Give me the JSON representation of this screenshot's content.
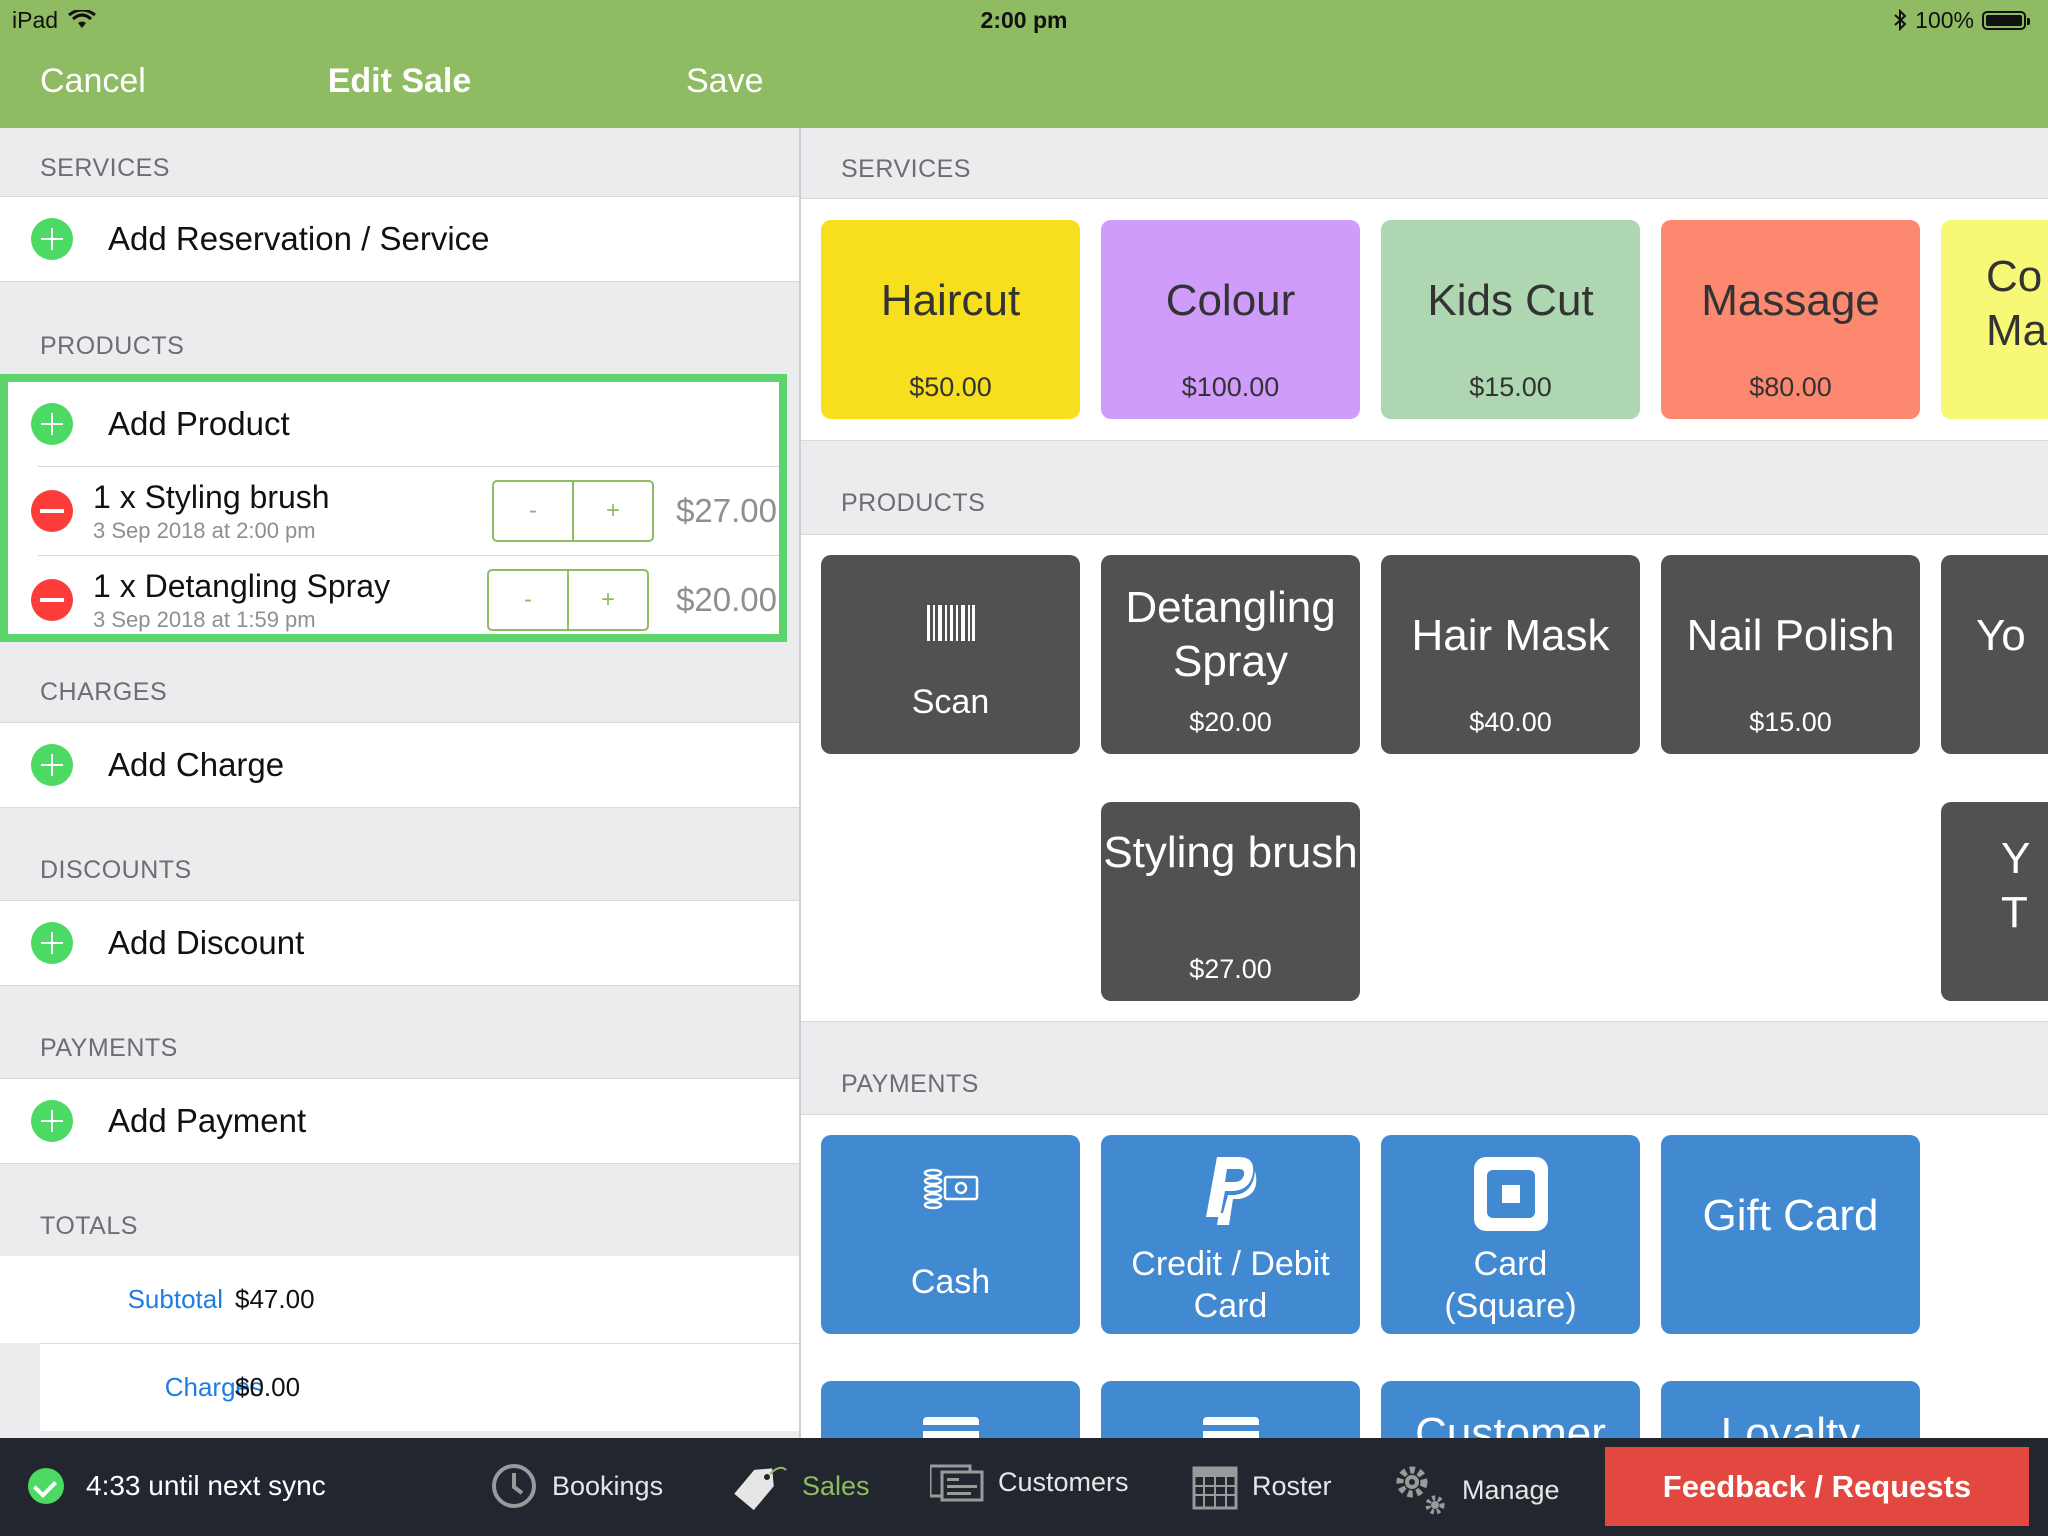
{
  "status_bar": {
    "device": "iPad",
    "time": "2:00 pm",
    "battery": "100%"
  },
  "nav": {
    "cancel": "Cancel",
    "title": "Edit Sale",
    "save": "Save"
  },
  "left": {
    "services_header": "SERVICES",
    "add_service": "Add Reservation / Service",
    "products_header": "PRODUCTS",
    "add_product": "Add Product",
    "items": [
      {
        "name": "1 x Styling brush",
        "date": "3 Sep 2018 at 2:00 pm",
        "minus": "-",
        "plus": "+",
        "price": "$27.00"
      },
      {
        "name": "1 x Detangling Spray",
        "date": "3 Sep 2018 at 1:59 pm",
        "minus": "-",
        "plus": "+",
        "price": "$20.00"
      }
    ],
    "charges_header": "CHARGES",
    "add_charge": "Add Charge",
    "discounts_header": "DISCOUNTS",
    "add_discount": "Add Discount",
    "payments_header": "PAYMENTS",
    "add_payment": "Add Payment",
    "totals_header": "TOTALS",
    "totals": [
      {
        "label": "Subtotal",
        "value": "$47.00"
      },
      {
        "label": "Charges",
        "value": "$0.00"
      }
    ]
  },
  "right": {
    "services_header": "SERVICES",
    "services": [
      {
        "name": "Haircut",
        "price": "$50.00",
        "color": "#f7df1e"
      },
      {
        "name": "Colour",
        "price": "$100.00",
        "color": "#cf9cfb"
      },
      {
        "name": "Kids Cut",
        "price": "$15.00",
        "color": "#add6b1"
      },
      {
        "name": "Massage",
        "price": "$80.00",
        "color": "#fd8870"
      },
      {
        "name": "Co Ma",
        "price": "",
        "color": "#f8f877"
      }
    ],
    "products_header": "PRODUCTS",
    "scan": "Scan",
    "products": [
      {
        "name": "Detangling Spray",
        "price": "$20.00"
      },
      {
        "name": "Hair Mask",
        "price": "$40.00"
      },
      {
        "name": "Nail Polish",
        "price": "$15.00"
      },
      {
        "name": "Yo",
        "price": ""
      },
      {
        "name": "Styling brush",
        "price": "$27.00"
      },
      {
        "name": "Y T",
        "price": ""
      }
    ],
    "payments_header": "PAYMENTS",
    "payments": [
      {
        "name": "Cash",
        "icon": "cash-icon"
      },
      {
        "name": "Credit / Debit Card",
        "icon": "paypal-icon"
      },
      {
        "name": "Card (Square)",
        "icon": "square-icon"
      },
      {
        "name": "Gift Card",
        "icon": ""
      },
      {
        "name": "",
        "icon": "card-icon"
      },
      {
        "name": "",
        "icon": "card-icon"
      },
      {
        "name": "Customer",
        "icon": ""
      },
      {
        "name": "Loyalty",
        "icon": ""
      }
    ]
  },
  "bottom": {
    "sync": "4:33 until next sync",
    "tabs": [
      "Bookings",
      "Sales",
      "Customers",
      "Roster",
      "Manage"
    ],
    "feedback": "Feedback / Requests"
  }
}
